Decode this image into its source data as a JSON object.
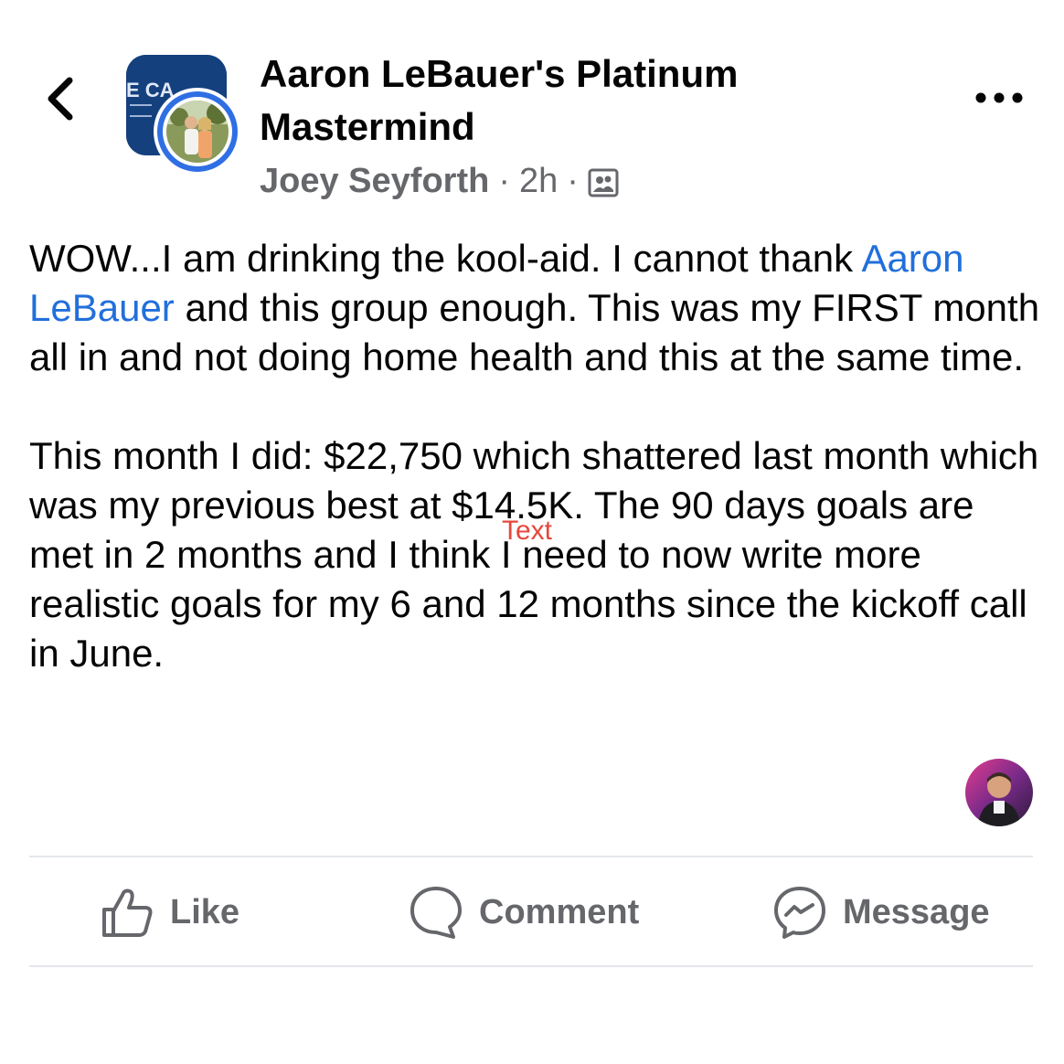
{
  "header": {
    "group_name": "Aaron LeBauer's Platinum Mastermind",
    "author": "Joey Seyforth",
    "separator": "·",
    "time": "2h",
    "audience_icon": "group-members-icon",
    "group_logo_text": "E CA",
    "more_icon": "more-horizontal-icon",
    "back_icon": "chevron-left-icon"
  },
  "post": {
    "para1_before_mention": "WOW...I am drinking the kool-aid. I cannot thank ",
    "mention": "Aaron LeBauer",
    "para1_after_mention": " and this group enough. This was my FIRST month all in and not doing home health and this at the same time.",
    "para2": "This month I did: $22,750 which shattered last month which was my previous best at $14.5K. The 90 days goals are met in 2 months and I think I need to now write more realistic goals for my 6 and 12 months since the kickoff call in June."
  },
  "overlay_label": "Text",
  "actions": {
    "like": "Like",
    "comment": "Comment",
    "message": "Message"
  },
  "colors": {
    "mention": "#216fdb",
    "secondary_text": "#65676b",
    "ring": "#2f6fe4",
    "overlay": "#e5483b"
  }
}
